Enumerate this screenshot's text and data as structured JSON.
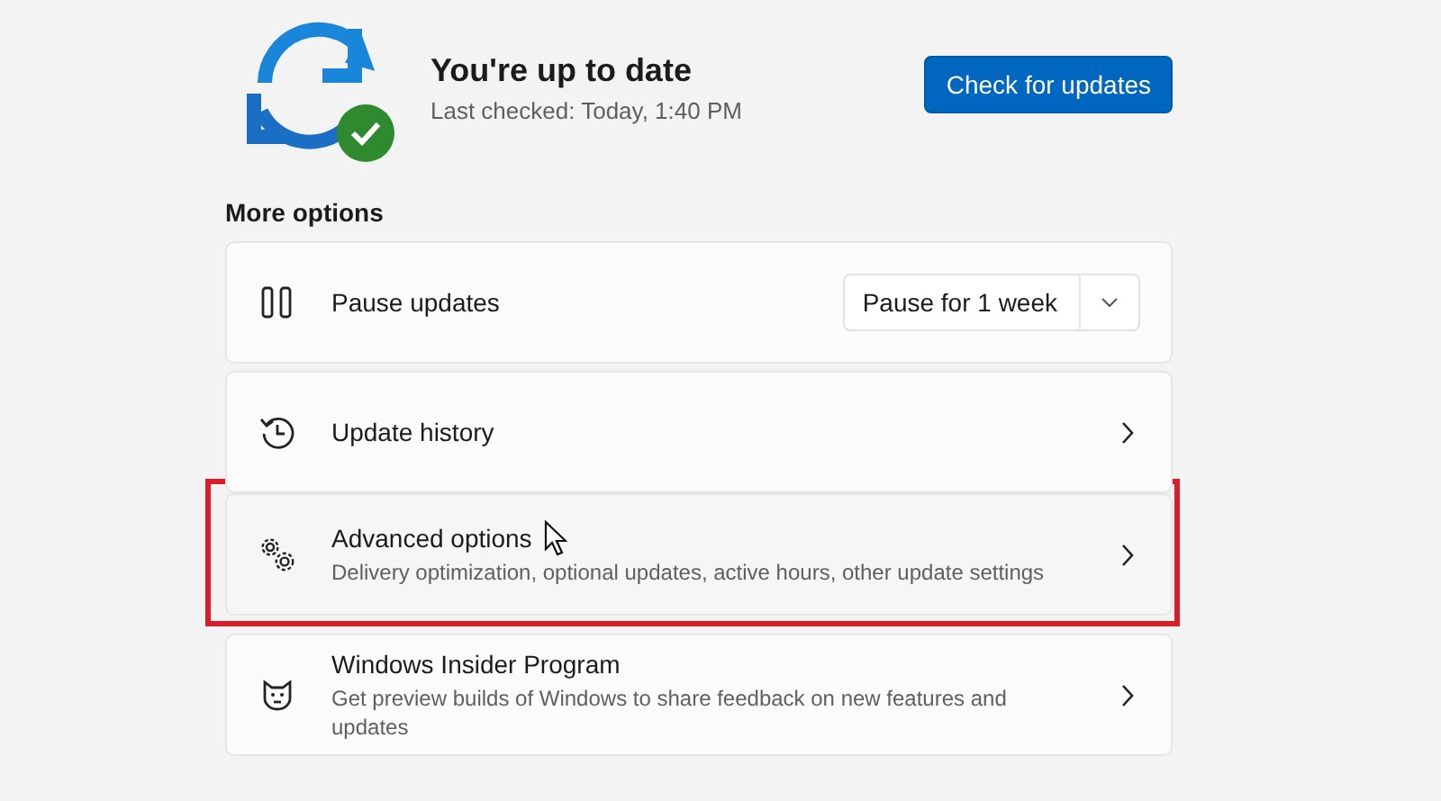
{
  "status": {
    "title": "You're up to date",
    "subtitle": "Last checked: Today, 1:40 PM",
    "button": "Check for updates"
  },
  "section_title": "More options",
  "options": [
    {
      "kind": "dropdown",
      "label": "Pause updates",
      "dropdown_value": "Pause for 1 week",
      "hovered": false,
      "highlighted": false
    },
    {
      "kind": "link",
      "label": "Update history",
      "hovered": false,
      "highlighted": false
    },
    {
      "kind": "link",
      "label": "Advanced options",
      "description": "Delivery optimization, optional updates, active hours, other update settings",
      "hovered": true,
      "highlighted": true
    },
    {
      "kind": "link",
      "label": "Windows Insider Program",
      "description": "Get preview builds of Windows to share feedback on new features and updates",
      "hovered": false,
      "highlighted": false
    }
  ]
}
